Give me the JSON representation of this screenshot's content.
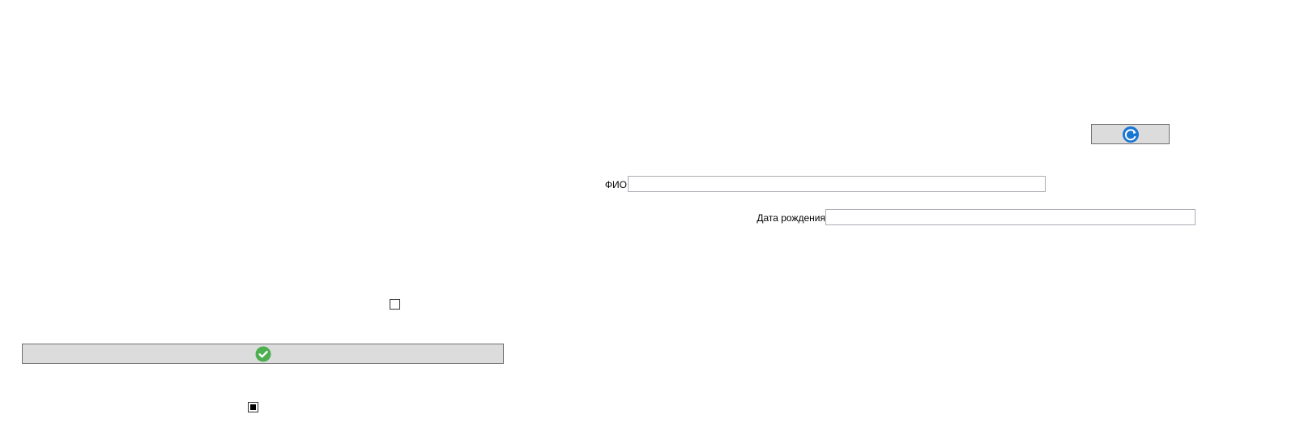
{
  "top_button": {
    "icon": "refresh-icon",
    "icon_color": "#1976d2"
  },
  "form": {
    "fio": {
      "label": "ФИО",
      "value": "",
      "placeholder": ""
    },
    "birth_date": {
      "label": "Дата рождения",
      "value": "",
      "placeholder": ""
    }
  },
  "checkboxes": [
    {
      "name": "checkbox-unchecked",
      "state": "unchecked"
    },
    {
      "name": "checkbox-indeterminate",
      "state": "indeterminate"
    }
  ],
  "confirm_button": {
    "icon": "check-circle-icon",
    "icon_color": "#4caf50"
  },
  "colors": {
    "button_bg": "#dcdcdc",
    "button_border": "#707070",
    "input_border": "#abadb3"
  }
}
